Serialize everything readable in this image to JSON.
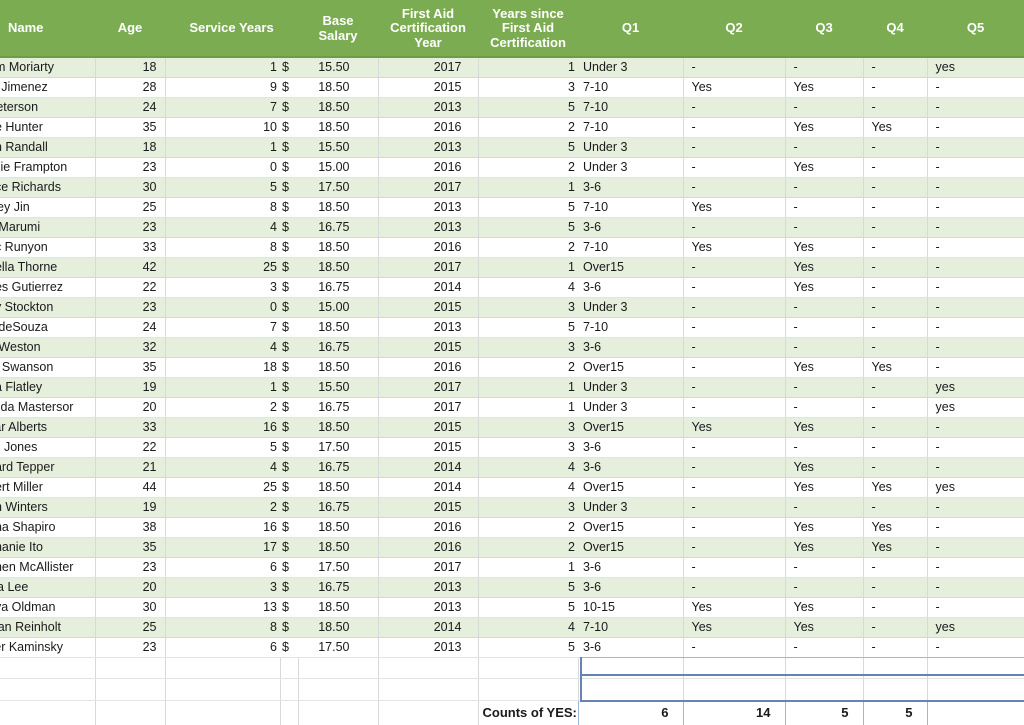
{
  "table": {
    "columns": [
      {
        "key": "name",
        "label": "Name"
      },
      {
        "key": "age",
        "label": "Age"
      },
      {
        "key": "serv",
        "label": "Service Years"
      },
      {
        "key": "sal",
        "label": "Base\nSalary"
      },
      {
        "key": "year",
        "label": "First Aid\nCertification\nYear"
      },
      {
        "key": "since",
        "label": "Years since\nFirst Aid\nCertification"
      },
      {
        "key": "q1",
        "label": "Q1"
      },
      {
        "key": "q2",
        "label": "Q2"
      },
      {
        "key": "q3",
        "label": "Q3"
      },
      {
        "key": "q4",
        "label": "Q4"
      },
      {
        "key": "q5",
        "label": "Q5"
      }
    ],
    "currency_symbol": "$",
    "rows": [
      {
        "name": "am Moriarty",
        "age": "18",
        "serv": "1",
        "sal": "15.50",
        "year": "2017",
        "since": "1",
        "q1": "Under 3",
        "q2": "-",
        "q3": "-",
        "q4": "-",
        "q5": "yes"
      },
      {
        "name": "ie Jimenez",
        "age": "28",
        "serv": "9",
        "sal": "18.50",
        "year": "2015",
        "since": "3",
        "q1": "7-10",
        "q2": "Yes",
        "q3": "Yes",
        "q4": "-",
        "q5": "-"
      },
      {
        "name": " Peterson",
        "age": "24",
        "serv": "7",
        "sal": "18.50",
        "year": "2013",
        "since": "5",
        "q1": "7-10",
        "q2": "-",
        "q3": "-",
        "q4": "-",
        "q5": "-"
      },
      {
        "name": "ire Hunter",
        "age": "35",
        "serv": "10",
        "sal": "18.50",
        "year": "2016",
        "since": "2",
        "q1": "7-10",
        "q2": "-",
        "q3": "Yes",
        "q4": "Yes",
        "q5": "-"
      },
      {
        "name": "en Randall",
        "age": "18",
        "serv": "1",
        "sal": "15.50",
        "year": "2013",
        "since": "5",
        "q1": "Under 3",
        "q2": "-",
        "q3": "-",
        "q4": "-",
        "q5": "-"
      },
      {
        "name": "ssie Frampton",
        "age": "23",
        "serv": "0",
        "sal": "15.00",
        "year": "2016",
        "since": "2",
        "q1": "Under 3",
        "q2": "-",
        "q3": "Yes",
        "q4": "-",
        "q5": "-"
      },
      {
        "name": "ace Richards",
        "age": "30",
        "serv": "5",
        "sal": "17.50",
        "year": "2017",
        "since": "1",
        "q1": "3-6",
        "q2": "-",
        "q3": "-",
        "q4": "-",
        "q5": "-"
      },
      {
        "name": "yley Jin",
        "age": "25",
        "serv": "8",
        "sal": "18.50",
        "year": "2013",
        "since": "5",
        "q1": "7-10",
        "q2": "Yes",
        "q3": "-",
        "q4": "-",
        "q5": "-"
      },
      {
        "name": "o Marumi",
        "age": "23",
        "serv": "4",
        "sal": "16.75",
        "year": "2013",
        "since": "5",
        "q1": "3-6",
        "q2": "-",
        "q3": "-",
        "q4": "-",
        "q5": "-"
      },
      {
        "name": "ac Runyon",
        "age": "33",
        "serv": "8",
        "sal": "18.50",
        "year": "2016",
        "since": "2",
        "q1": "7-10",
        "q2": "Yes",
        "q3": "Yes",
        "q4": "-",
        "q5": "-"
      },
      {
        "name": "bella Thorne",
        "age": "42",
        "serv": "25",
        "sal": "18.50",
        "year": "2017",
        "since": "1",
        "q1": "Over15",
        "q2": "-",
        "q3": "Yes",
        "q4": "-",
        "q5": "-"
      },
      {
        "name": "nes Gutierrez",
        "age": "22",
        "serv": "3",
        "sal": "16.75",
        "year": "2014",
        "since": "4",
        "q1": "3-6",
        "q2": "-",
        "q3": "Yes",
        "q4": "-",
        "q5": "-"
      },
      {
        "name": "ey Stockton",
        "age": "23",
        "serv": "0",
        "sal": "15.00",
        "year": "2015",
        "since": "3",
        "q1": "Under 3",
        "q2": "-",
        "q3": "-",
        "q4": "-",
        "q5": "-"
      },
      {
        "name": "o deSouza",
        "age": "24",
        "serv": "7",
        "sal": "18.50",
        "year": "2013",
        "since": "5",
        "q1": "7-10",
        "q2": "-",
        "q3": "-",
        "q4": "-",
        "q5": "-"
      },
      {
        "name": "a Weston",
        "age": "32",
        "serv": "4",
        "sal": "16.75",
        "year": "2015",
        "since": "3",
        "q1": "3-6",
        "q2": "-",
        "q3": "-",
        "q4": "-",
        "q5": "-"
      },
      {
        "name": "m Swanson",
        "age": "35",
        "serv": "18",
        "sal": "18.50",
        "year": "2016",
        "since": "2",
        "q1": "Over15",
        "q2": "-",
        "q3": "Yes",
        "q4": "Yes",
        "q5": "-"
      },
      {
        "name": "ria Flatley",
        "age": "19",
        "serv": "1",
        "sal": "15.50",
        "year": "2017",
        "since": "1",
        "q1": "Under 3",
        "q2": "-",
        "q3": "-",
        "q4": "-",
        "q5": "yes"
      },
      {
        "name": "linda Mastersor",
        "age": "20",
        "serv": "2",
        "sal": "16.75",
        "year": "2017",
        "since": "1",
        "q1": "Under 3",
        "q2": "-",
        "q3": "-",
        "q4": "-",
        "q5": "yes"
      },
      {
        "name": "car Alberts",
        "age": "33",
        "serv": "16",
        "sal": "18.50",
        "year": "2015",
        "since": "3",
        "q1": "Over15",
        "q2": "Yes",
        "q3": "Yes",
        "q4": "-",
        "q5": "-"
      },
      {
        "name": "lip Jones",
        "age": "22",
        "serv": "5",
        "sal": "17.50",
        "year": "2015",
        "since": "3",
        "q1": "3-6",
        "q2": "-",
        "q3": "-",
        "q4": "-",
        "q5": "-"
      },
      {
        "name": "hard Tepper",
        "age": "21",
        "serv": "4",
        "sal": "16.75",
        "year": "2014",
        "since": "4",
        "q1": "3-6",
        "q2": "-",
        "q3": "Yes",
        "q4": "-",
        "q5": "-"
      },
      {
        "name": "bert Miller",
        "age": "44",
        "serv": "25",
        "sal": "18.50",
        "year": "2014",
        "since": "4",
        "q1": "Over15",
        "q2": "-",
        "q3": "Yes",
        "q4": "Yes",
        "q5": "yes"
      },
      {
        "name": "ah Winters",
        "age": "19",
        "serv": "2",
        "sal": "16.75",
        "year": "2015",
        "since": "3",
        "q1": "Under 3",
        "q2": "-",
        "q3": "-",
        "q4": "-",
        "q5": "-"
      },
      {
        "name": "nna Shapiro",
        "age": "38",
        "serv": "16",
        "sal": "18.50",
        "year": "2016",
        "since": "2",
        "q1": "Over15",
        "q2": "-",
        "q3": "Yes",
        "q4": "Yes",
        "q5": "-"
      },
      {
        "name": "phanie Ito",
        "age": "35",
        "serv": "17",
        "sal": "18.50",
        "year": "2016",
        "since": "2",
        "q1": "Over15",
        "q2": "-",
        "q3": "Yes",
        "q4": "Yes",
        "q5": "-"
      },
      {
        "name": "phen McAllister",
        "age": "23",
        "serv": "6",
        "sal": "17.50",
        "year": "2017",
        "since": "1",
        "q1": "3-6",
        "q2": "-",
        "q3": "-",
        "q4": "-",
        "q5": "-"
      },
      {
        "name": "via Lee",
        "age": "20",
        "serv": "3",
        "sal": "16.75",
        "year": "2013",
        "since": "5",
        "q1": "3-6",
        "q2": "-",
        "q3": "-",
        "q4": "-",
        "q5": "-"
      },
      {
        "name": "nya Oldman",
        "age": "30",
        "serv": "13",
        "sal": "18.50",
        "year": "2013",
        "since": "5",
        "q1": "10-15",
        "q2": "Yes",
        "q3": "Yes",
        "q4": "-",
        "q5": "-"
      },
      {
        "name": "stan Reinholt",
        "age": "25",
        "serv": "8",
        "sal": "18.50",
        "year": "2014",
        "since": "4",
        "q1": "7-10",
        "q2": "Yes",
        "q3": "Yes",
        "q4": "-",
        "q5": "yes"
      },
      {
        "name": "lter Kaminsky",
        "age": "23",
        "serv": "6",
        "sal": "17.50",
        "year": "2013",
        "since": "5",
        "q1": "3-6",
        "q2": "-",
        "q3": "-",
        "q4": "-",
        "q5": "-"
      }
    ],
    "totals": {
      "label": "Counts of YES:",
      "q2": "6",
      "q3": "14",
      "q4": "5",
      "q5": "5"
    }
  },
  "colors": {
    "header_green": "#7BAC52",
    "band_green": "#E5EFDC",
    "selection_blue": "#6583b5"
  }
}
